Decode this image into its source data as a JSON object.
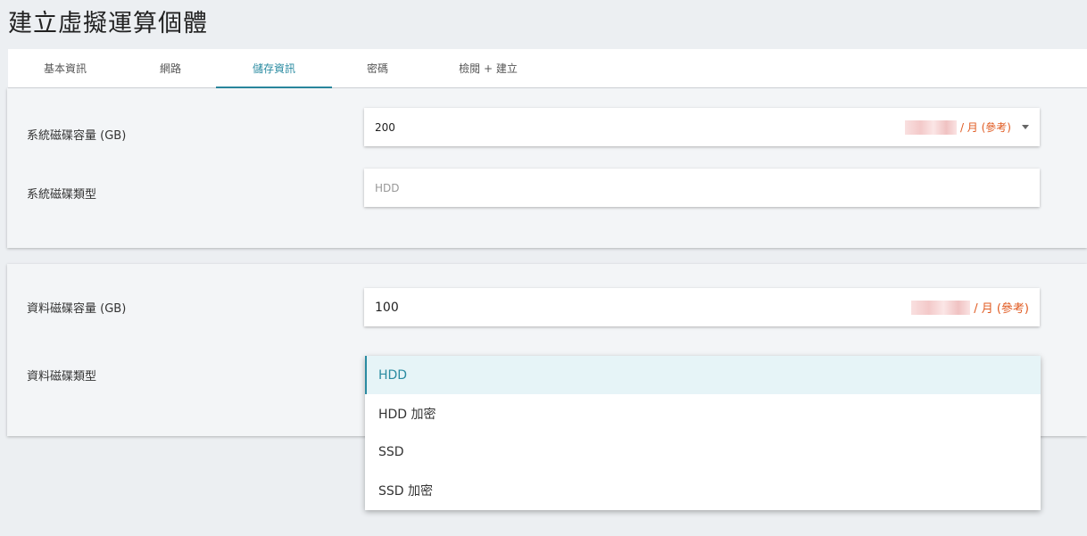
{
  "page": {
    "title": "建立虛擬運算個體"
  },
  "tabs": [
    {
      "label": "基本資訊"
    },
    {
      "label": "網路"
    },
    {
      "label": "儲存資訊"
    },
    {
      "label": "密碼"
    },
    {
      "label": "檢閱 + 建立"
    }
  ],
  "active_tab": "儲存資訊",
  "system_disk": {
    "capacity_label": "系統磁碟容量 (GB)",
    "capacity_value": "200",
    "price_suffix": "/ 月 (參考)",
    "type_label": "系統磁碟類型",
    "type_placeholder": "HDD"
  },
  "data_disk": {
    "capacity_label": "資料磁碟容量 (GB)",
    "capacity_value": "100",
    "price_suffix": "/ 月 (參考)",
    "type_label": "資料磁碟類型"
  },
  "dropdown": {
    "options": [
      "HDD",
      "HDD 加密",
      "SSD",
      "SSD 加密"
    ],
    "selected": "HDD"
  },
  "colors": {
    "accent": "#2a8ba1",
    "price": "#e0591f",
    "background": "#eceff2"
  }
}
